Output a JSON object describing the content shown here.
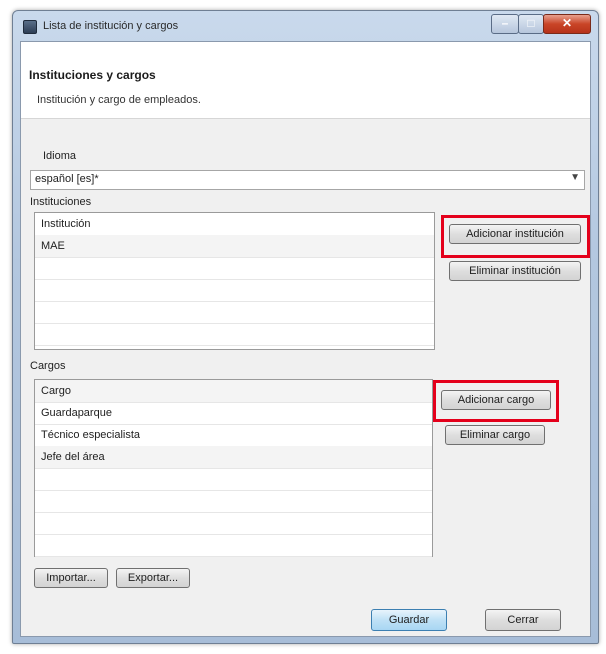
{
  "window": {
    "title": "Lista de institución y cargos"
  },
  "header": {
    "title": "Instituciones y cargos",
    "description": "Institución y cargo de empleados."
  },
  "language": {
    "label": "Idioma",
    "value": "español [es]*"
  },
  "institutions": {
    "label": "Instituciones",
    "rows": [
      "Institución",
      "MAE",
      "",
      "",
      "",
      ""
    ],
    "add_button": "Adicionar institución",
    "remove_button": "Eliminar institución"
  },
  "positions": {
    "label": "Cargos",
    "rows": [
      "Cargo",
      "Guardaparque",
      "Técnico especialista",
      "Jefe del área",
      "",
      "",
      "",
      ""
    ],
    "add_button": "Adicionar cargo",
    "remove_button": "Eliminar cargo"
  },
  "footer": {
    "import_button": "Importar...",
    "export_button": "Exportar...",
    "save_button": "Guardar",
    "close_button": "Cerrar"
  },
  "colors": {
    "highlight": "#e4001b",
    "accent": "#3c7fb1"
  },
  "icons": {
    "dropdown": "chevron-down-icon",
    "close": "close-icon",
    "minimize": "minimize-icon",
    "maximize": "maximize-icon"
  }
}
